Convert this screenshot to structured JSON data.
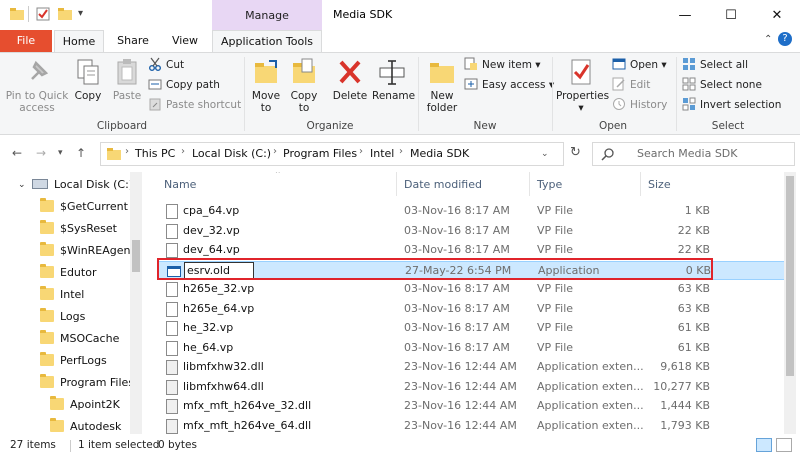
{
  "window": {
    "title": "Media SDK",
    "contextual_group": "Manage",
    "controls": {
      "minimize": "—",
      "maximize": "☐",
      "close": "✕"
    }
  },
  "tabs": [
    {
      "label": "File"
    },
    {
      "label": "Home"
    },
    {
      "label": "Share"
    },
    {
      "label": "View"
    },
    {
      "label": "Application Tools"
    }
  ],
  "ribbon": {
    "clipboard": {
      "pin": "Pin to Quick",
      "pin2": "access",
      "copy": "Copy",
      "paste": "Paste",
      "cut": "Cut",
      "copy_path": "Copy path",
      "paste_shortcut": "Paste shortcut",
      "group": "Clipboard"
    },
    "organize": {
      "move": "Move",
      "move2": "to",
      "copy": "Copy",
      "copy2": "to",
      "delete": "Delete",
      "rename": "Rename",
      "group": "Organize"
    },
    "new": {
      "new_folder": "New",
      "new_folder2": "folder",
      "new_item": "New item",
      "easy_access": "Easy access",
      "group": "New"
    },
    "open": {
      "properties": "Properties",
      "open": "Open",
      "edit": "Edit",
      "history": "History",
      "group": "Open"
    },
    "select": {
      "select_all": "Select all",
      "select_none": "Select none",
      "invert": "Invert selection",
      "group": "Select"
    }
  },
  "address": {
    "breadcrumbs": [
      "This PC",
      "Local Disk (C:)",
      "Program Files",
      "Intel",
      "Media SDK"
    ],
    "search_placeholder": "Search Media SDK"
  },
  "nav_pane": [
    {
      "label": "Local Disk (C:)",
      "kind": "drive"
    },
    {
      "label": "$GetCurrent"
    },
    {
      "label": "$SysReset"
    },
    {
      "label": "$WinREAgent"
    },
    {
      "label": "Edutor"
    },
    {
      "label": "Intel"
    },
    {
      "label": "Logs"
    },
    {
      "label": "MSOCache"
    },
    {
      "label": "PerfLogs"
    },
    {
      "label": "Program Files"
    },
    {
      "label": "Apoint2K"
    },
    {
      "label": "Autodesk"
    }
  ],
  "columns": {
    "name": "Name",
    "date": "Date modified",
    "type": "Type",
    "size": "Size"
  },
  "files": [
    {
      "name": "cpa_64.vp",
      "date": "03-Nov-16 8:17 AM",
      "type": "VP File",
      "size": "1 KB",
      "icon": "file-icon"
    },
    {
      "name": "dev_32.vp",
      "date": "03-Nov-16 8:17 AM",
      "type": "VP File",
      "size": "22 KB",
      "icon": "file-icon"
    },
    {
      "name": "dev_64.vp",
      "date": "03-Nov-16 8:17 AM",
      "type": "VP File",
      "size": "22 KB",
      "icon": "file-icon"
    },
    {
      "name": "esrv.old",
      "date": "27-May-22 6:54 PM",
      "type": "Application",
      "size": "0 KB",
      "icon": "app-icon",
      "selected": true,
      "renaming": true
    },
    {
      "name": "h265e_32.vp",
      "date": "03-Nov-16 8:17 AM",
      "type": "VP File",
      "size": "63 KB",
      "icon": "file-icon"
    },
    {
      "name": "h265e_64.vp",
      "date": "03-Nov-16 8:17 AM",
      "type": "VP File",
      "size": "63 KB",
      "icon": "file-icon"
    },
    {
      "name": "he_32.vp",
      "date": "03-Nov-16 8:17 AM",
      "type": "VP File",
      "size": "61 KB",
      "icon": "file-icon"
    },
    {
      "name": "he_64.vp",
      "date": "03-Nov-16 8:17 AM",
      "type": "VP File",
      "size": "61 KB",
      "icon": "file-icon"
    },
    {
      "name": "libmfxhw32.dll",
      "date": "23-Nov-16 12:44 AM",
      "type": "Application exten...",
      "size": "9,618 KB",
      "icon": "dll-icon"
    },
    {
      "name": "libmfxhw64.dll",
      "date": "23-Nov-16 12:44 AM",
      "type": "Application exten...",
      "size": "10,277 KB",
      "icon": "dll-icon"
    },
    {
      "name": "mfx_mft_h264ve_32.dll",
      "date": "23-Nov-16 12:44 AM",
      "type": "Application exten...",
      "size": "1,444 KB",
      "icon": "dll-icon"
    },
    {
      "name": "mfx_mft_h264ve_64.dll",
      "date": "23-Nov-16 12:44 AM",
      "type": "Application exten...",
      "size": "1,793 KB",
      "icon": "dll-icon"
    }
  ],
  "status": {
    "items": "27 items",
    "selected": "1 item selected",
    "size": "0 bytes"
  },
  "colors": {
    "file_tab": "#e64e2f",
    "manage_tab": "#e8d7f4",
    "selection": "#cce8ff",
    "highlight_box": "#e0242b",
    "folder": "#f8d775"
  }
}
